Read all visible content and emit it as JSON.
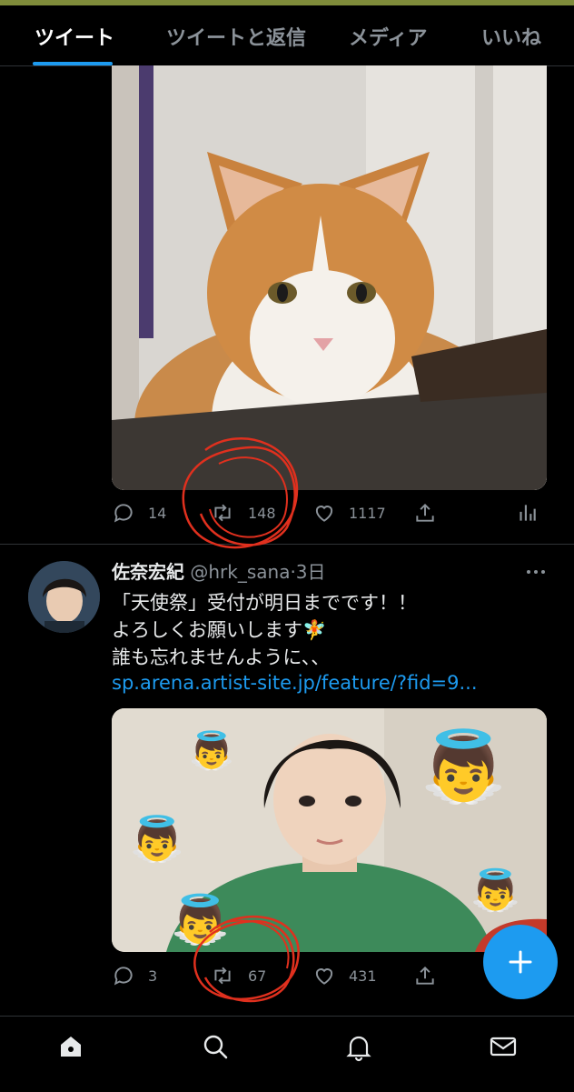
{
  "tabs": [
    {
      "label": "ツイート",
      "active": true
    },
    {
      "label": "ツイートと返信",
      "active": false
    },
    {
      "label": "メディア",
      "active": false
    },
    {
      "label": "いいね",
      "active": false
    }
  ],
  "tweet1": {
    "reply_count": "14",
    "retweet_count": "148",
    "like_count": "1117"
  },
  "tweet2": {
    "name": "佐奈宏紀",
    "handle": "@hrk_sana",
    "time": "·3日",
    "lines": [
      "「天使祭」受付が明日までです！！",
      "よろしくお願いします🧚",
      "誰も忘れませんように、、"
    ],
    "link": "sp.arena.artist-site.jp/feature/?fid=9...",
    "reply_count": "3",
    "retweet_count": "67",
    "like_count": "431"
  },
  "fab_label": "+",
  "bottom_nav": [
    "home-icon",
    "search-icon",
    "notifications-icon",
    "messages-icon"
  ],
  "colors": {
    "accent": "#1d9bf0",
    "background": "#000000",
    "secondary_text": "#8b9299",
    "annotation": "#e0301e"
  }
}
